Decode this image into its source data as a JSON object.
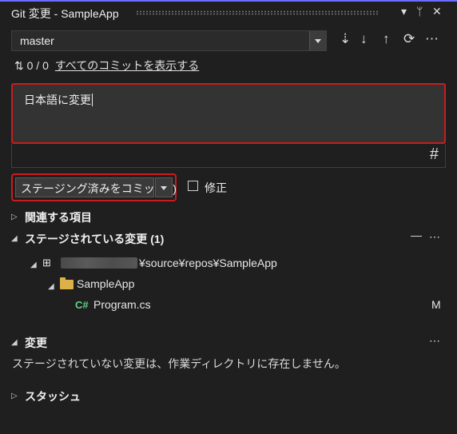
{
  "window": {
    "title": "Git 変更 - SampleApp",
    "icons": {
      "dropdown": "▾",
      "pin": "ᛘ",
      "close": "✕"
    }
  },
  "branch": {
    "selected": "master"
  },
  "actions": {
    "fetch": "⇣",
    "pull": "↓",
    "push": "↑",
    "sync": "⟳",
    "more": "⋯"
  },
  "sync": {
    "icon": "⇅",
    "counts": "0 / 0",
    "link": "すべてのコミットを表示する"
  },
  "commit_message": {
    "text": "日本語に変更",
    "hash_icon": "#"
  },
  "commit": {
    "button": "ステージング済みをコミット(I)",
    "amend_label": "修正"
  },
  "sections": {
    "related": "関連する項目",
    "staged": "ステージされている変更 (1)",
    "staged_actions": {
      "unstage": "—",
      "more": "⋯"
    },
    "repo_path": "¥source¥repos¥SampleApp",
    "folder": "SampleApp",
    "file": {
      "lang": "C#",
      "name": "Program.cs",
      "status": "M"
    },
    "changes": "変更",
    "changes_more": "⋯",
    "changes_empty": "ステージされていない変更は、作業ディレクトリに存在しません。",
    "stash": "スタッシュ"
  }
}
